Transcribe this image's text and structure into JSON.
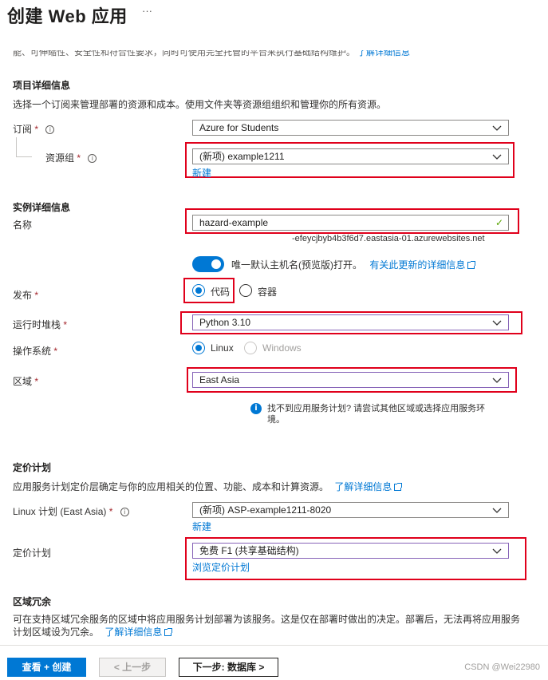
{
  "header": {
    "title": "创建 Web 应用",
    "more": "···"
  },
  "top_clipped": {
    "text": "能、可伸缩性、安全性和符合性要求，同时可使用完全托管的平台来执行基础结构维护。",
    "link": "了解详细信息"
  },
  "project": {
    "heading": "项目详细信息",
    "description": "选择一个订阅来管理部署的资源和成本。使用文件夹等资源组组织和管理你的所有资源。",
    "subscription_label": "订阅",
    "subscription_value": "Azure for Students",
    "resource_group_label": "资源组",
    "resource_group_value": "(新项) example1211",
    "resource_group_new": "新建",
    "required_mark": "*",
    "info_glyph": "i"
  },
  "instance": {
    "heading": "实例详细信息",
    "name_label": "名称",
    "name_value": "hazard-example",
    "valid_mark": "✓",
    "domain_suffix": "-efeycjbyb4b3f6d7.eastasia-01.azurewebsites.net",
    "unique_hostname_text": "唯一默认主机名(预览版)打开。",
    "unique_hostname_link": "有关此更新的详细信息",
    "publish_label": "发布",
    "publish_options": [
      "代码",
      "容器"
    ],
    "publish_selected": "代码",
    "runtime_label": "运行时堆栈",
    "runtime_value": "Python 3.10",
    "os_label": "操作系统",
    "os_options": [
      "Linux",
      "Windows"
    ],
    "os_selected": "Linux",
    "region_label": "区域",
    "region_value": "East Asia",
    "region_info": "找不到应用服务计划? 请尝试其他区域或选择应用服务环境。",
    "region_info_glyph": "i"
  },
  "pricing": {
    "heading": "定价计划",
    "description": "应用服务计划定价层确定与你的应用相关的位置、功能、成本和计算资源。",
    "learn_more": "了解详细信息",
    "linux_plan_label": "Linux 计划 (East Asia)",
    "linux_plan_value": "(新项) ASP-example1211-8020",
    "linux_plan_new": "新建",
    "price_plan_label": "定价计划",
    "price_plan_value": "免费 F1 (共享基础结构)",
    "browse_link": "浏览定价计划"
  },
  "zone": {
    "heading": "区域冗余",
    "description_line1": "可在支持区域冗余服务的区域中将应用服务计划部署为该服务。这是仅在部署时做出的决定。部署后，无法再将应用服务",
    "description_line2": "计划区域设为冗余。",
    "learn_more": "了解详细信息"
  },
  "footer": {
    "review_button": "查看 + 创建",
    "prev_button": "< 上一步",
    "next_button": "下一步: 数据库 >",
    "watermark": "CSDN @Wei22980"
  },
  "colors": {
    "accent": "#0078d4",
    "highlight_box": "#e0001b",
    "required": "#a4262c",
    "valid": "#57a300"
  }
}
